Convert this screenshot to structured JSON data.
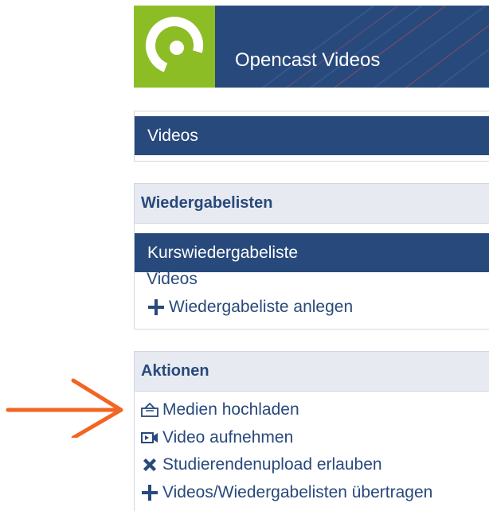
{
  "banner": {
    "title": "Opencast Videos",
    "logo_icon": "opencast-logo-icon",
    "colors": {
      "logo_bg": "#8cbd25",
      "banner_bg": "#28497c"
    }
  },
  "nav": {
    "videos_label": "Videos"
  },
  "playlists": {
    "header": "Wiedergabelisten",
    "active_item": "Kurswiedergabeliste",
    "items": [
      {
        "label": "Videos"
      },
      {
        "label": "Wiedergabeliste anlegen",
        "icon": "plus-icon"
      }
    ]
  },
  "actions": {
    "header": "Aktionen",
    "items": [
      {
        "label": "Medien hochladen",
        "icon": "upload-icon"
      },
      {
        "label": "Video aufnehmen",
        "icon": "video-camera-icon"
      },
      {
        "label": "Studierendenupload erlauben",
        "icon": "x-icon"
      },
      {
        "label": "Videos/Wiedergabelisten übertragen",
        "icon": "plus-icon"
      }
    ]
  },
  "annotation": {
    "arrow_icon": "orange-arrow-icon",
    "color": "#f26522"
  }
}
